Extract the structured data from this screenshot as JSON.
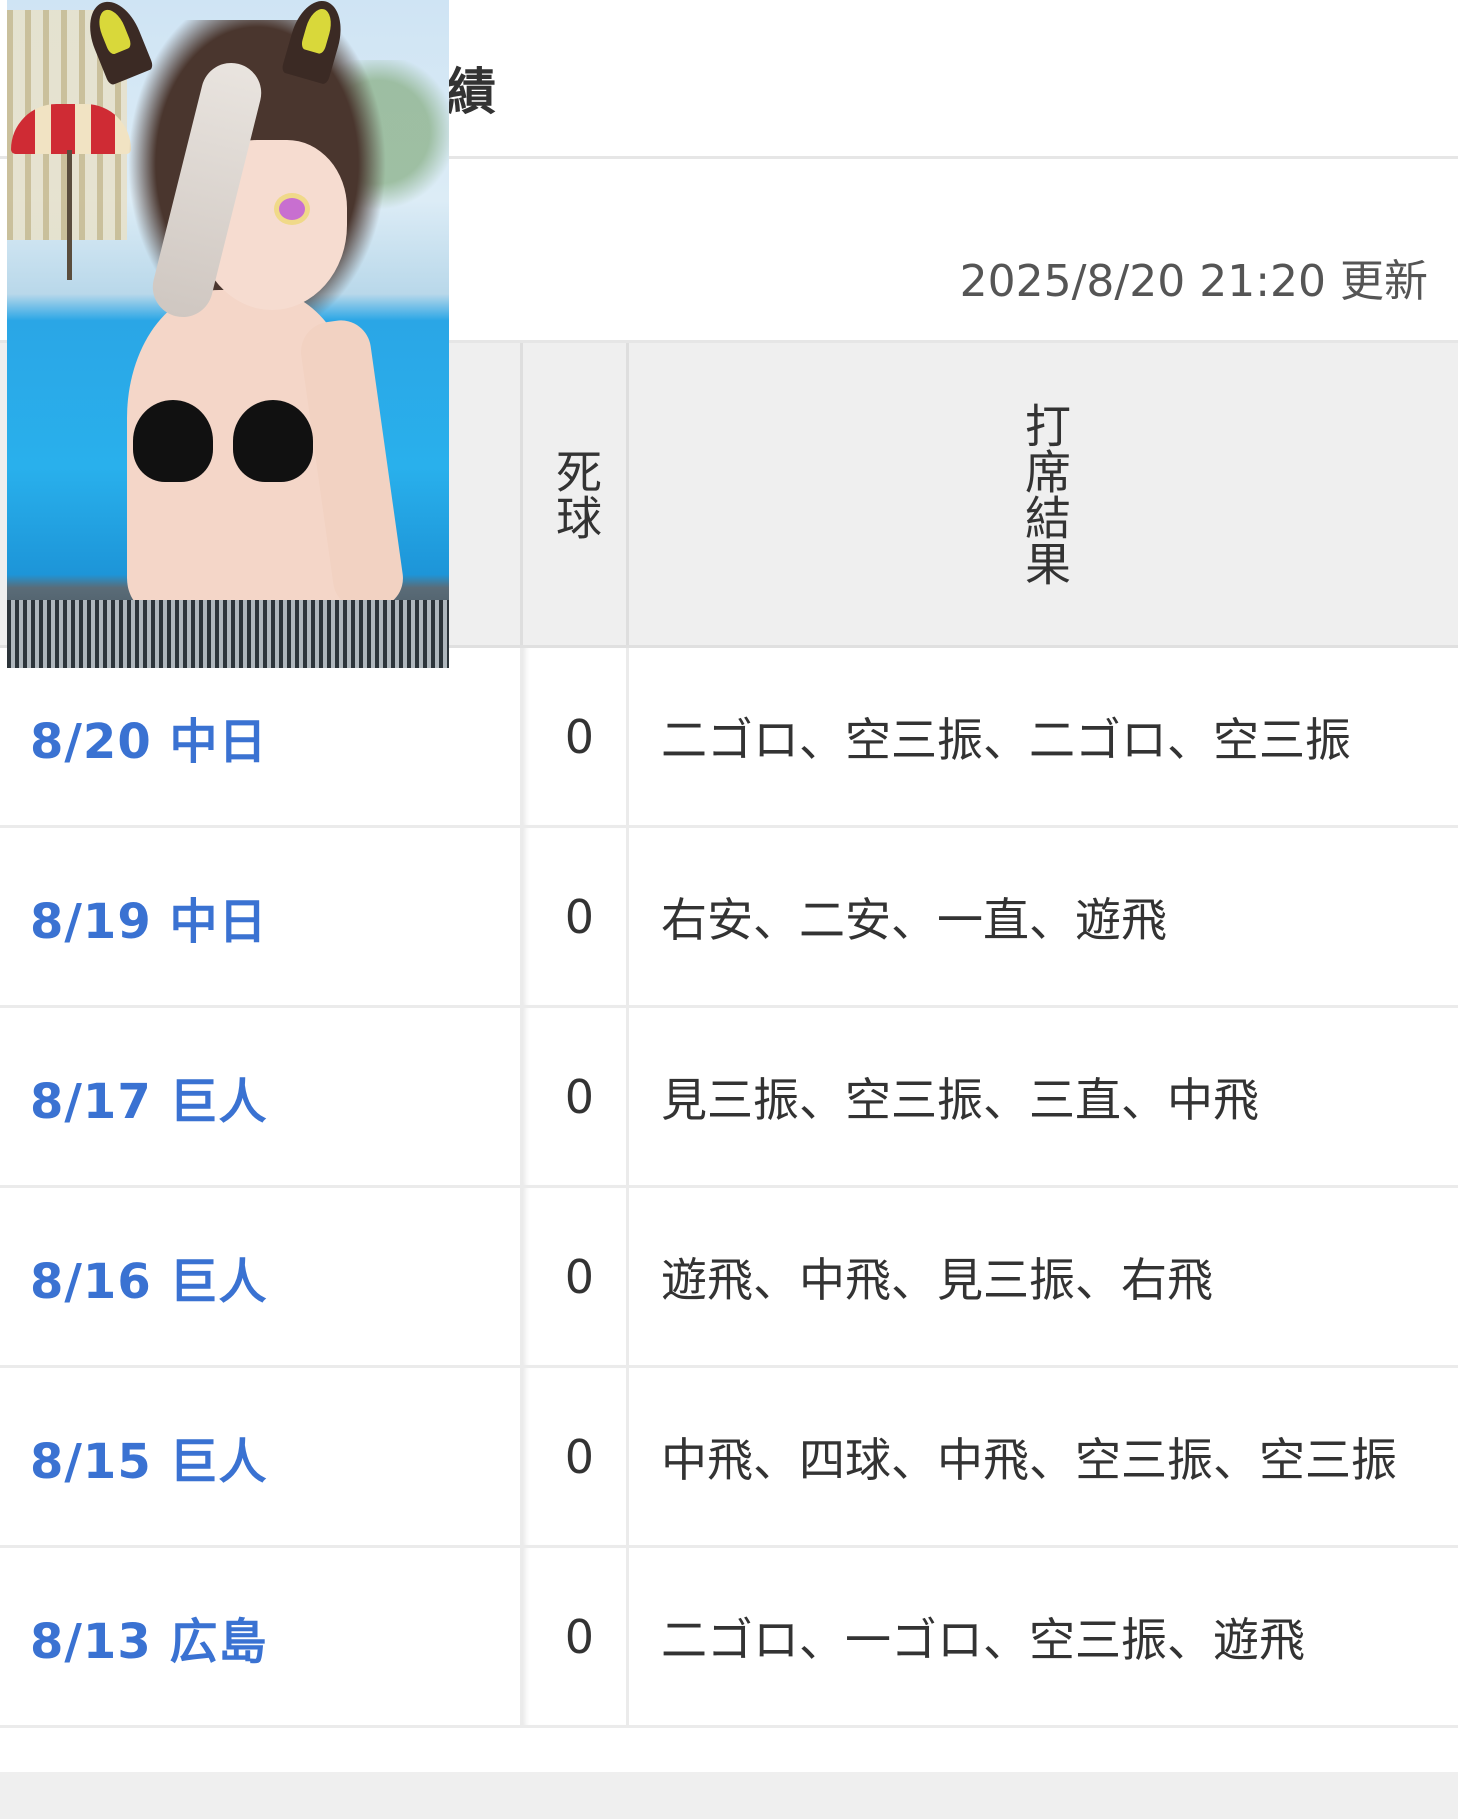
{
  "header": {
    "title_fragment": "績",
    "updated_at": "2025/8/20 21:20 更新"
  },
  "table": {
    "columns": {
      "dead_ball": "死球",
      "at_bat_result": "打席結果"
    },
    "rows": [
      {
        "date": "8/20 中日",
        "dead_ball": "0",
        "results": "二ゴロ、空三振、二ゴロ、空三振"
      },
      {
        "date": "8/19 中日",
        "dead_ball": "0",
        "results": "右安、二安、一直、遊飛"
      },
      {
        "date": "8/17 巨人",
        "dead_ball": "0",
        "results": "見三振、空三振、三直、中飛"
      },
      {
        "date": "8/16 巨人",
        "dead_ball": "0",
        "results": "遊飛、中飛、見三振、右飛"
      },
      {
        "date": "8/15 巨人",
        "dead_ball": "0",
        "results": "中飛、四球、中飛、空三振、空三振"
      },
      {
        "date": "8/13 広島",
        "dead_ball": "0",
        "results": "二ゴロ、一ゴロ、空三振、遊飛"
      }
    ]
  },
  "colors": {
    "link_blue": "#3a72d2",
    "header_bg": "#efefef",
    "text": "#333333"
  },
  "overlay": {
    "description_icon": "illustration-image"
  }
}
